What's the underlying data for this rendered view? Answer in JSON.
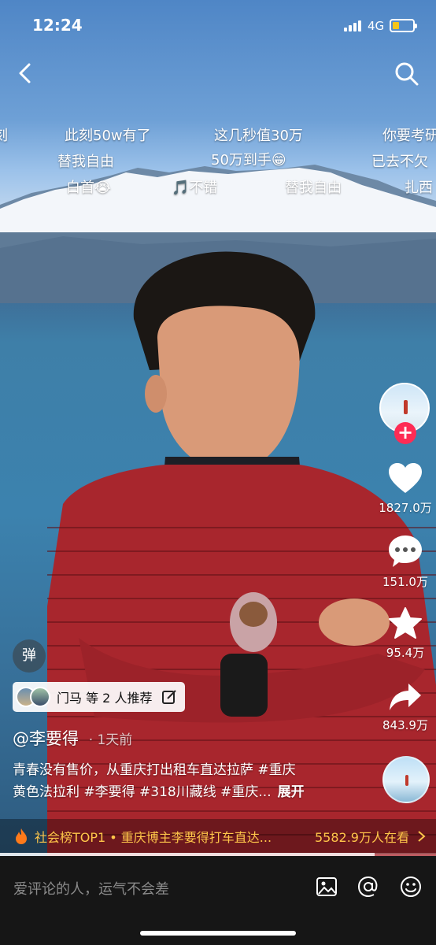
{
  "status_bar": {
    "time": "12:24",
    "network": "4G",
    "battery_color": "#f5c518"
  },
  "danmaku": [
    {
      "text": "刻",
      "row": 1,
      "col": 0
    },
    {
      "text": "此刻50w有了",
      "row": 1,
      "col": 1
    },
    {
      "text": "这几秒值30万",
      "row": 1,
      "col": 2
    },
    {
      "text": "你要考研",
      "row": 1,
      "col": 3
    },
    {
      "text": "替我自由",
      "row": 2,
      "col": 1
    },
    {
      "text": "50万到手😁",
      "row": 2,
      "col": 2
    },
    {
      "text": "已去不欠",
      "row": 2,
      "col": 3
    },
    {
      "text": "白首😭",
      "row": 3,
      "col": 1
    },
    {
      "text": "🎵不错",
      "row": 3,
      "col": 2
    },
    {
      "text": "替我自由",
      "row": 3,
      "col": 3
    },
    {
      "text": "扎西",
      "row": 3,
      "col": 4
    }
  ],
  "actions": {
    "likes": "1827.0万",
    "comments": "151.0万",
    "favorites": "95.4万",
    "shares": "843.9万"
  },
  "danmu_toggle_label": "弹",
  "recommend": {
    "text": "门马 等 2 人推荐"
  },
  "author": {
    "handle": "@李要得",
    "time_ago": "· 1天前"
  },
  "caption": {
    "line1": "青春没有售价，从重庆打出租车直达拉萨 #重庆",
    "line2": "黄色法拉利 #李要得 #318川藏线 #重庆...",
    "expand": "展开"
  },
  "hot_bar": {
    "text": "社会榜TOP1 • 重庆博主李要得打车直达...",
    "count": "5582.9万人在看",
    "color": "#ffc64a"
  },
  "progress": 0.86,
  "comment_bar": {
    "placeholder": "爱评论的人，运气不会差"
  },
  "colors": {
    "accent": "#fe2c55"
  }
}
